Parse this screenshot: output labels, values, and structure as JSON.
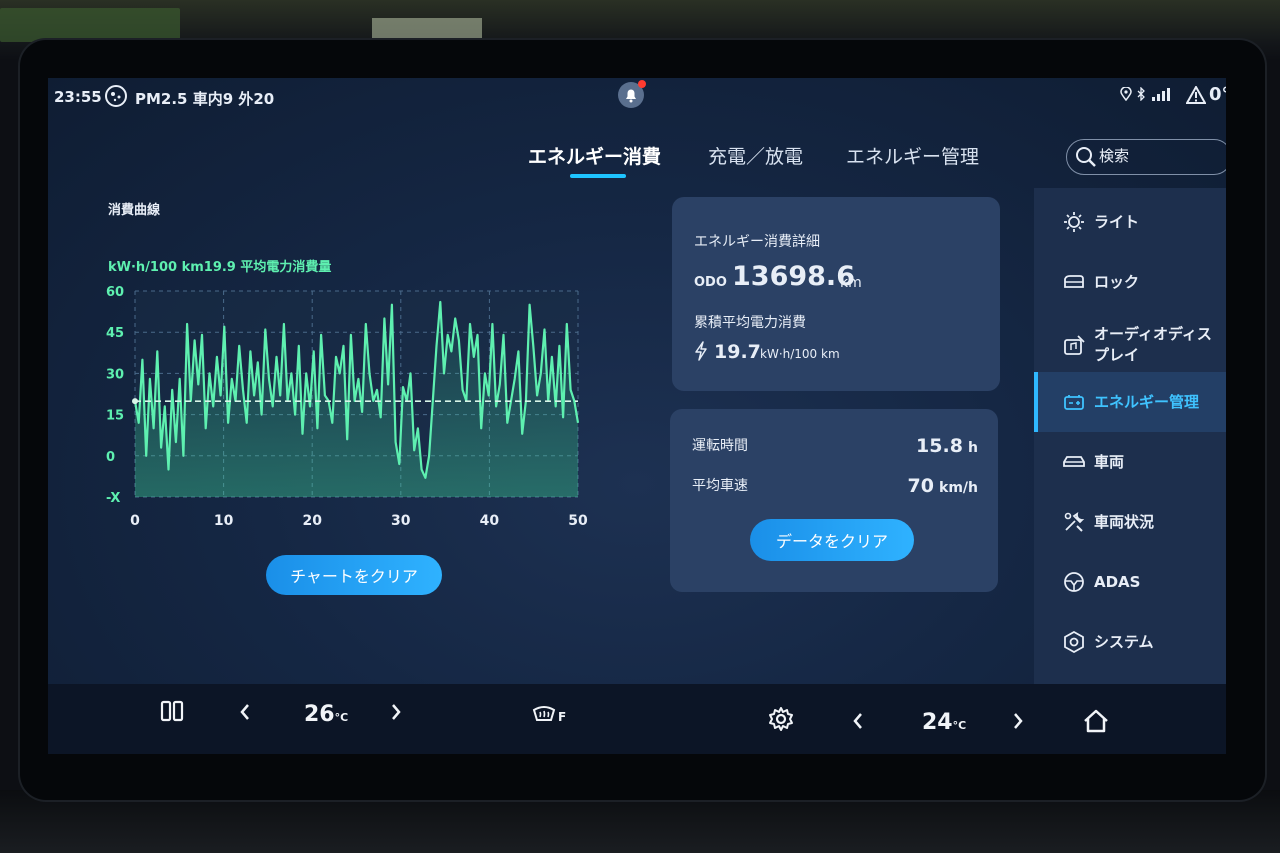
{
  "status_bar": {
    "time": "23:55",
    "air_quality": "PM2.5 車内9 外20",
    "outside_temp": "0°"
  },
  "tabs": [
    {
      "label": "エネルギー消費",
      "active": true
    },
    {
      "label": "充電／放電",
      "active": false
    },
    {
      "label": "エネルギー管理",
      "active": false
    }
  ],
  "search": {
    "placeholder": "検索"
  },
  "consumption": {
    "section_title": "消費曲線",
    "subtitle": "kW·h/100 km19.9  平均電力消費量",
    "clear_button": "チャートをクリア"
  },
  "chart_data": {
    "type": "line",
    "title": "",
    "xlabel": "",
    "ylabel": "",
    "x_ticks": [
      "0",
      "10",
      "20",
      "30",
      "40",
      "50"
    ],
    "y_ticks": [
      "-X",
      "0",
      "15",
      "30",
      "45",
      "60"
    ],
    "xlim": [
      0,
      50
    ],
    "ylim": [
      -15,
      60
    ],
    "average": 19.9,
    "grid": true,
    "series": [
      {
        "values": [
          20,
          12,
          35,
          0,
          28,
          10,
          38,
          3,
          18,
          -5,
          24,
          5,
          28,
          0,
          48,
          20,
          42,
          26,
          44,
          10,
          30,
          18,
          36,
          22,
          47,
          12,
          28,
          20,
          40,
          24,
          12,
          38,
          22,
          34,
          15,
          46,
          28,
          18,
          36,
          22,
          48,
          20,
          30,
          15,
          40,
          8,
          30,
          18,
          38,
          10,
          44,
          22,
          20,
          12,
          36,
          30,
          40,
          6,
          44,
          20,
          28,
          16,
          48,
          30,
          20,
          24,
          14,
          50,
          26,
          55,
          5,
          -3,
          25,
          20,
          30,
          2,
          10,
          -5,
          -8,
          0,
          20,
          40,
          56,
          30,
          44,
          38,
          50,
          42,
          24,
          20,
          48,
          36,
          44,
          10,
          30,
          22,
          48,
          18,
          26,
          44,
          12,
          20,
          28,
          38,
          8,
          20,
          55,
          40,
          22,
          30,
          46,
          20,
          36,
          18,
          40,
          14,
          48,
          24,
          20,
          12
        ]
      }
    ]
  },
  "energy_details": {
    "title": "エネルギー消費詳細",
    "odo_label": "ODO",
    "odo_value": "13698.6",
    "odo_unit": "km",
    "avg_label": "累積平均電力消費",
    "avg_value": "19.7",
    "avg_unit": "kW·h/100 km"
  },
  "drive_stats": {
    "drive_time_label": "運転時間",
    "drive_time_value": "15.8",
    "drive_time_unit": "h",
    "avg_speed_label": "平均車速",
    "avg_speed_value": "70",
    "avg_speed_unit": "km/h",
    "clear_button": "データをクリア"
  },
  "sidebar": {
    "items": [
      {
        "label": "ライト",
        "icon": "light-icon"
      },
      {
        "label": "ロック",
        "icon": "lock-icon"
      },
      {
        "label": "オーディオディス\nプレイ",
        "icon": "audio-display-icon"
      },
      {
        "label": "エネルギー管理",
        "icon": "battery-icon",
        "active": true
      },
      {
        "label": "車両",
        "icon": "car-icon"
      },
      {
        "label": "車両状況",
        "icon": "vehicle-status-icon"
      },
      {
        "label": "ADAS",
        "icon": "steering-wheel-icon"
      },
      {
        "label": "システム",
        "icon": "system-icon"
      }
    ]
  },
  "dock": {
    "left_temp": "26",
    "right_temp": "24",
    "temp_unit": "°C",
    "defrost_label": "F"
  },
  "colors": {
    "accent": "#1ec4ff",
    "chart_line": "#5ef0b0",
    "card_bg": "#2b4165"
  }
}
